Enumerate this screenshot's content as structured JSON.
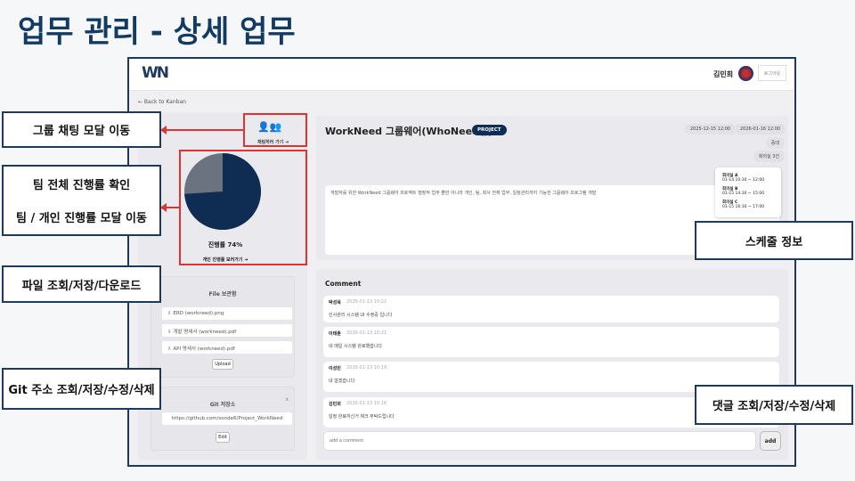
{
  "slide_title": "업무 관리 - 상세 업무",
  "header": {
    "logo": "WN",
    "user_name": "김민희",
    "logout": "로그아웃"
  },
  "back_link": "← Back to Kanban",
  "chat": {
    "label": "채팅하러 가기 ➜"
  },
  "progress": {
    "value": 74,
    "label": "진행률 74%",
    "link": "개인 진행률 보러가기 ➜",
    "colors": {
      "done": "#0f2d52",
      "rest": "#6b7280"
    }
  },
  "files": {
    "title": "File 보관함",
    "items": [
      "ERD (workneed).png",
      "개발 명세서 (workneed).pdf",
      "API 명세서 (workneed).pdf"
    ],
    "upload": "Upload"
  },
  "git": {
    "title": "Git 저장소",
    "url": "https://github.com/sonde6/Project_WorkNeed",
    "edit": "Edit",
    "close": "x"
  },
  "task": {
    "title": "WorkNeed 그룹웨어(WhoNeed팀)",
    "badge": "PROJECT",
    "start": "2025-12-15 12:00",
    "end": "2026-01-16 12:00",
    "priority": "중대",
    "room": "회의실 3건",
    "description": "개발자를 위한 WorkNeed 그룹웨어 프로젝트 행정적 업무 뿐만 아니라 개인, 팀, 회사 전체 업무, 일정관리까지 가능한 그룹웨어 프로그램 개발"
  },
  "schedule": [
    {
      "room": "회의실 A",
      "time": "01-14 10:30 ~ 12:00"
    },
    {
      "room": "회의실 B",
      "time": "01-15 14:30 ~ 15:00"
    },
    {
      "room": "회의실 C",
      "time": "01-15 16:30 ~ 17:00"
    }
  ],
  "comments": {
    "title": "Comment",
    "items": [
      {
        "name": "박성욱",
        "date": "2026-01-13 10:22",
        "text": "인사관리 시스템 UI 수정중 입니다"
      },
      {
        "name": "이태훈",
        "date": "2026-01-13 10:21",
        "text": "네 메일 시스템 완료했습니다"
      },
      {
        "name": "이성빈",
        "date": "2026-01-13 10:19",
        "text": "네 알겠습니다"
      },
      {
        "name": "김민희",
        "date": "2026-01-13 10:18",
        "text": "일정 완료하신거 체크 부탁드립니다"
      }
    ],
    "placeholder": "add a comment",
    "add": "add"
  },
  "callouts": {
    "chat": "그룹 채팅 모달 이동",
    "progress1": "팀 전체 진행률 확인",
    "progress2": "팀 / 개인 진행률 모달 이동",
    "files": "파일 조회/저장/다운로드",
    "git": "Git 주소 조회/저장/수정/삭제",
    "schedule": "스케줄 정보",
    "comments": "댓글 조회/저장/수정/삭제"
  }
}
